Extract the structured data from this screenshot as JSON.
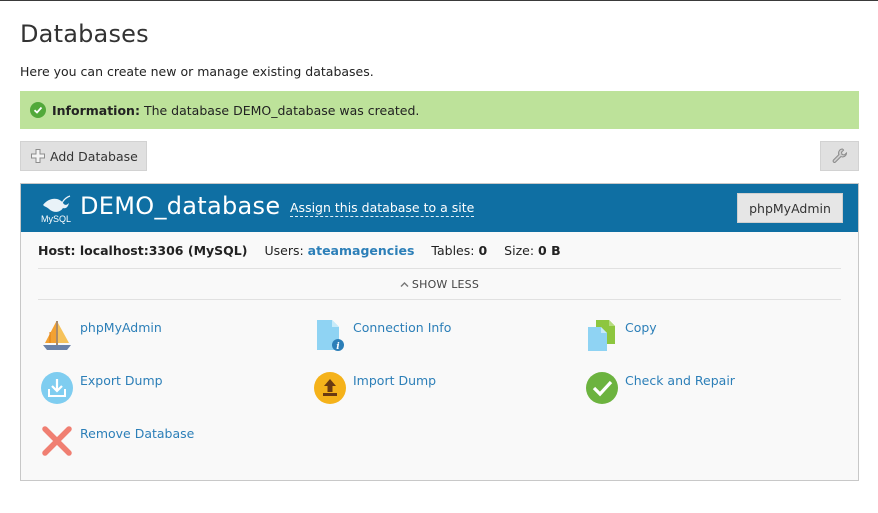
{
  "page": {
    "title": "Databases",
    "description": "Here you can create new or manage existing databases."
  },
  "info": {
    "label": "Information:",
    "message": "The database DEMO_database was created."
  },
  "toolbar": {
    "add_database_label": "Add Database"
  },
  "database": {
    "name": "DEMO_database",
    "assign_link": "Assign this database to a site",
    "phpmyadmin_button": "phpMyAdmin",
    "logo_text": "MySQL",
    "host_label": "Host: localhost:3306 (MySQL)",
    "users_label": "Users:",
    "users_value": "ateamagencies",
    "tables_label": "Tables:",
    "tables_value": "0",
    "size_label": "Size:",
    "size_value": "0 B",
    "show_less": "SHOW LESS"
  },
  "actions": {
    "phpmyadmin": "phpMyAdmin",
    "connection_info": "Connection Info",
    "copy": "Copy",
    "export_dump": "Export Dump",
    "import_dump": "Import Dump",
    "check_repair": "Check and Repair",
    "remove_database": "Remove Database"
  },
  "colors": {
    "header_blue": "#0f6fa3",
    "info_green": "#bde29a",
    "link_blue": "#2c7fb8"
  }
}
